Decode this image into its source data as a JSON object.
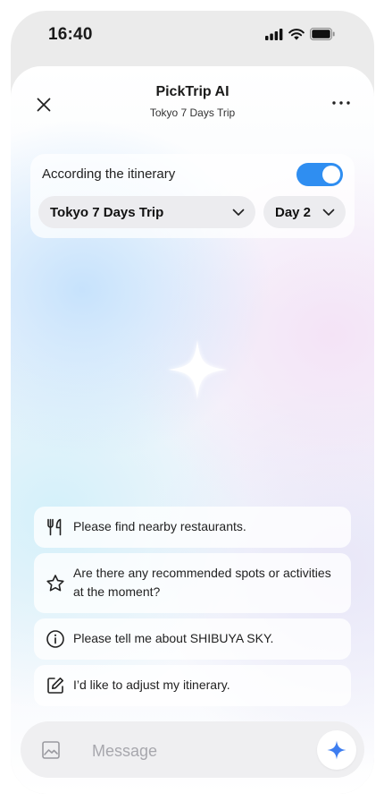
{
  "status_bar": {
    "time": "16:40",
    "icons": [
      "signal-icon",
      "wifi-icon",
      "battery-icon"
    ]
  },
  "header": {
    "title": "PickTrip AI",
    "subtitle": "Tokyo 7 Days Trip",
    "close_icon": "close-icon",
    "more_icon": "more-icon"
  },
  "itinerary_card": {
    "label": "According the itinerary",
    "toggle_on": true,
    "trip_select": "Tokyo 7 Days Trip",
    "day_select": "Day 2"
  },
  "suggestions": [
    {
      "icon": "fork-knife-icon",
      "text": "Please find nearby restaurants."
    },
    {
      "icon": "star-icon",
      "text": "Are there any recommended spots or activities at the moment?"
    },
    {
      "icon": "info-icon",
      "text": "Please tell me about SHIBUYA SKY."
    },
    {
      "icon": "edit-icon",
      "text": "I’d like to adjust my itinerary."
    }
  ],
  "composer": {
    "placeholder": "Message",
    "image_icon": "image-icon",
    "send_icon": "sparkle-icon"
  },
  "colors": {
    "accent": "#2F8EF1",
    "sparkle_blue": "#3D7DF0",
    "phone_frame": "#EBEBEB"
  }
}
